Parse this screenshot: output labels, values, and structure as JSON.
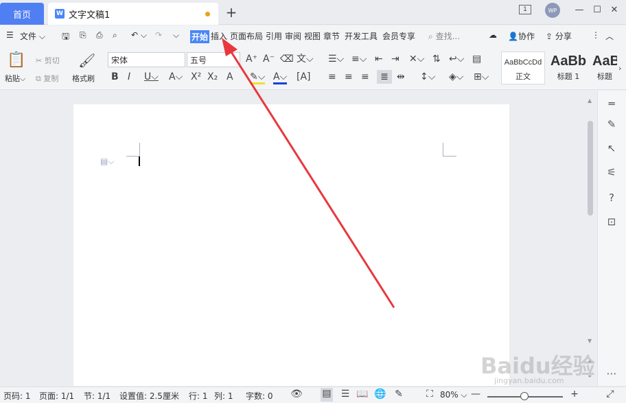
{
  "tabs": {
    "home": "首页",
    "doc": "文字文稿1",
    "doc_icon": "W",
    "add": "+"
  },
  "window": {
    "avatar": "WP",
    "badge": "1"
  },
  "menu": {
    "file": "文件",
    "start": "开始",
    "items": [
      "插入",
      "页面布局",
      "引用",
      "审阅",
      "视图",
      "章节",
      "开发工具",
      "会员专享"
    ],
    "search": "查找...",
    "collab": "协作",
    "share": "分享"
  },
  "ribbon": {
    "paste": "粘贴",
    "cut": "剪切",
    "copy": "复制",
    "format_painter": "格式刷",
    "font": "宋体",
    "size": "五号",
    "styles": [
      {
        "preview": "AaBbCcDd",
        "name": "正文"
      },
      {
        "preview": "AaBb",
        "name": "标题 1"
      },
      {
        "preview": "AaB",
        "name": "标题"
      }
    ]
  },
  "status": {
    "page_code": "页码: 1",
    "pages": "页面: 1/1",
    "section": "节: 1/1",
    "setting": "设置值: 2.5厘米",
    "row": "行: 1",
    "col": "列: 1",
    "words": "字数: 0",
    "zoom": "80%"
  },
  "watermark": {
    "text": "Baidu经验",
    "url": "jingyan.baidu.com"
  },
  "colors": {
    "accent": "#4a86f7",
    "home_tab": "#4f7ff2",
    "arrow": "#e8383d"
  }
}
